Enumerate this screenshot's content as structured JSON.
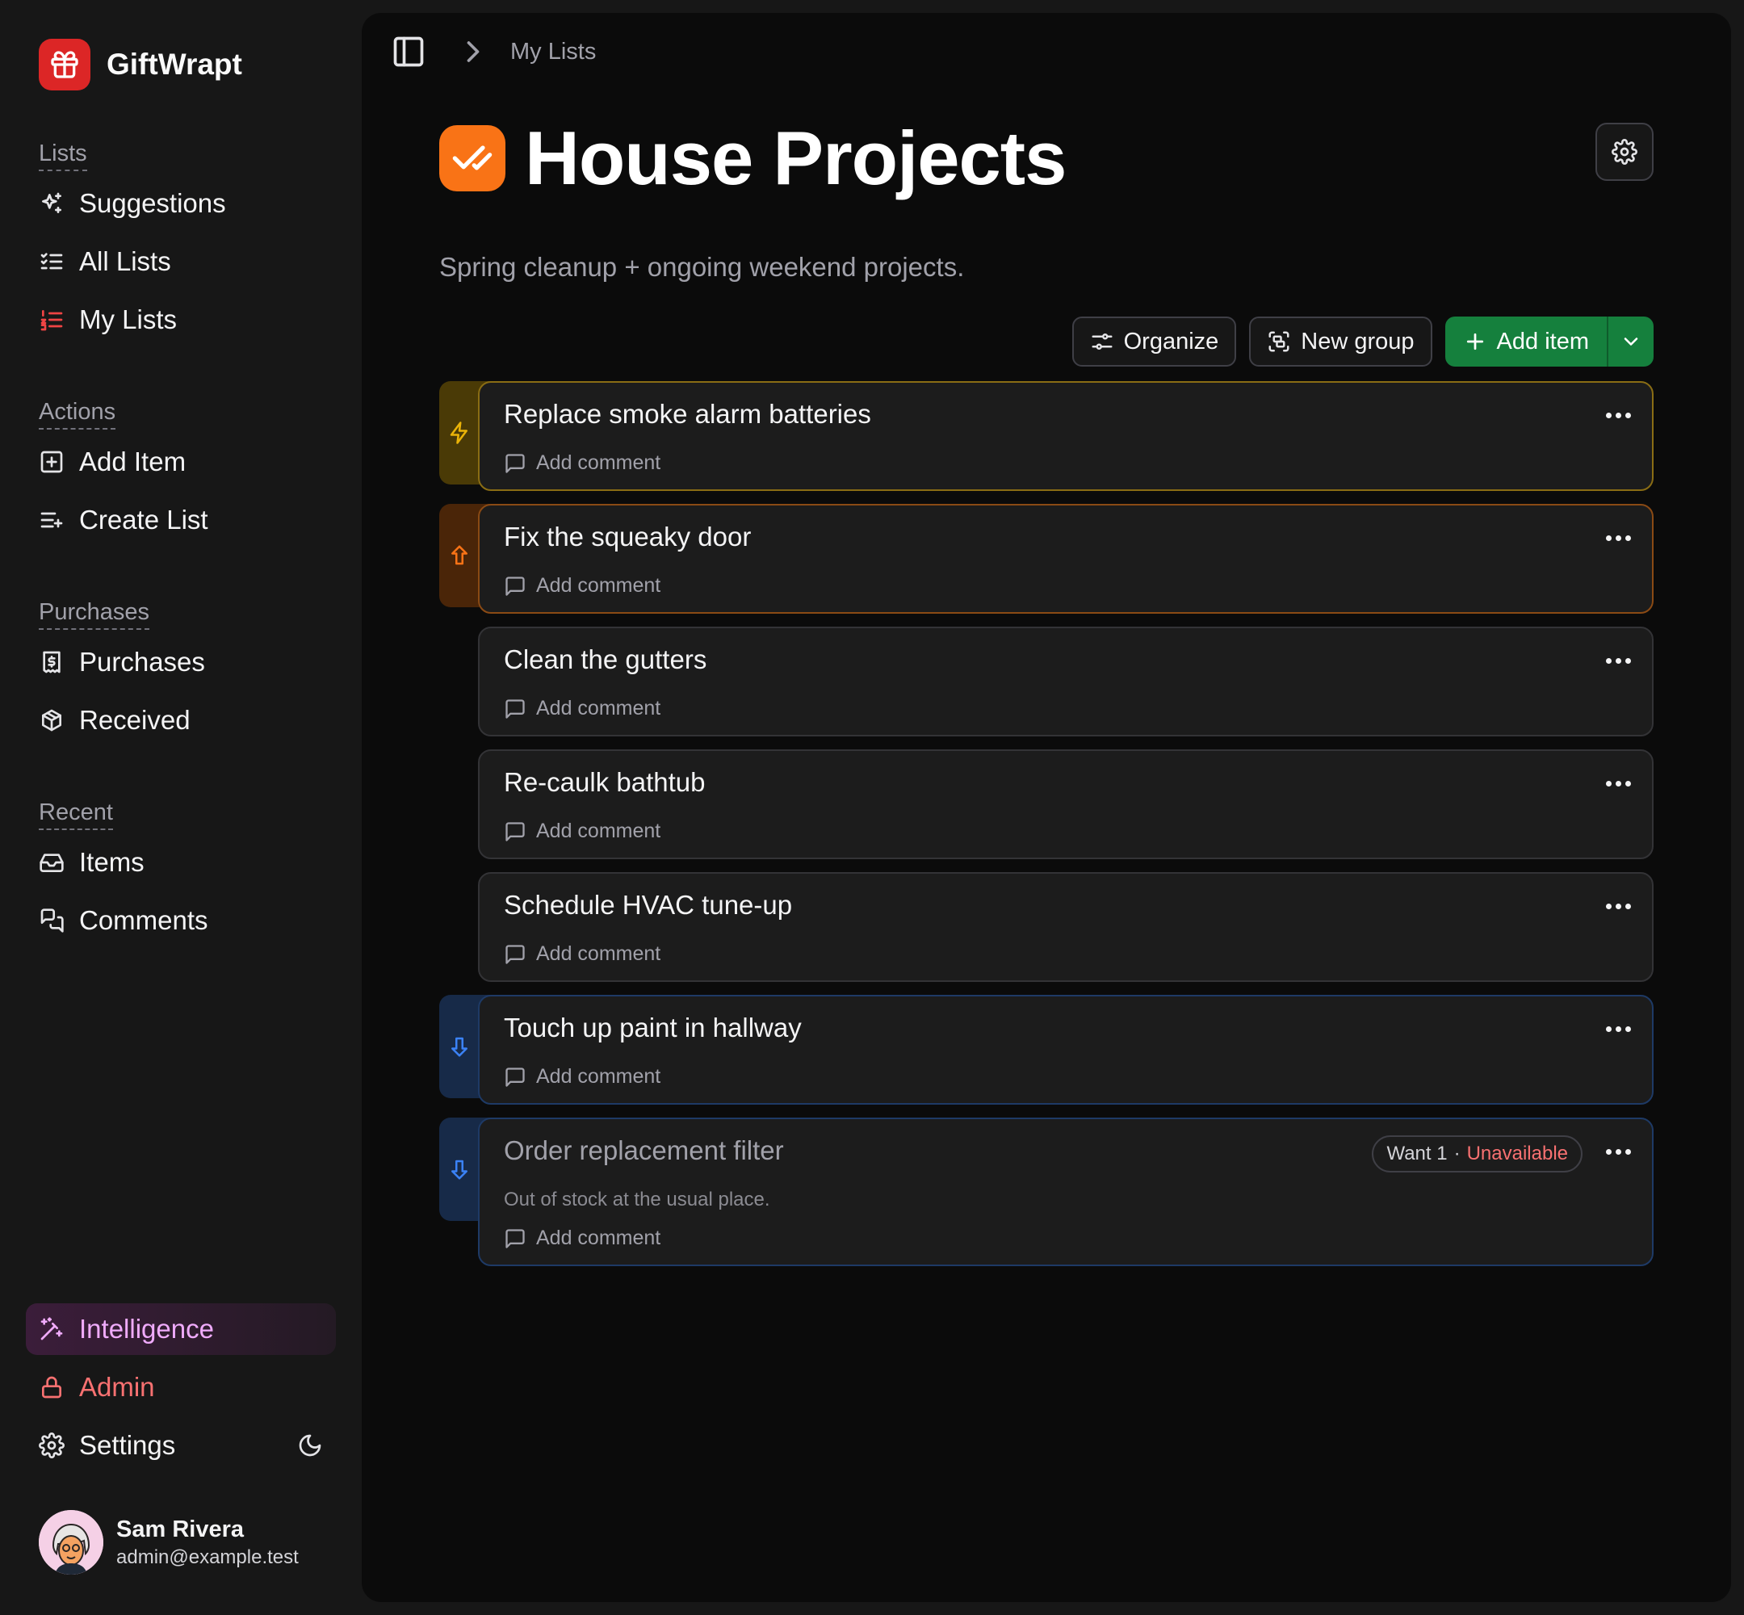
{
  "app": {
    "name": "GiftWrapt"
  },
  "sidebar": {
    "sections": [
      {
        "label": "Lists",
        "items": [
          {
            "label": "Suggestions",
            "icon": "sparkles-icon"
          },
          {
            "label": "All Lists",
            "icon": "list-checks-icon"
          },
          {
            "label": "My Lists",
            "icon": "list-ordered-icon"
          }
        ]
      },
      {
        "label": "Actions",
        "items": [
          {
            "label": "Add Item",
            "icon": "square-plus-icon"
          },
          {
            "label": "Create List",
            "icon": "list-plus-icon"
          }
        ]
      },
      {
        "label": "Purchases",
        "items": [
          {
            "label": "Purchases",
            "icon": "receipt-icon"
          },
          {
            "label": "Received",
            "icon": "package-icon"
          }
        ]
      },
      {
        "label": "Recent",
        "items": [
          {
            "label": "Items",
            "icon": "inbox-icon"
          },
          {
            "label": "Comments",
            "icon": "messages-icon"
          }
        ]
      }
    ],
    "bottom": {
      "intelligence": "Intelligence",
      "admin": "Admin",
      "settings": "Settings"
    },
    "user": {
      "name": "Sam Rivera",
      "email": "admin@example.test"
    }
  },
  "breadcrumb": {
    "current": "My Lists"
  },
  "list": {
    "title": "House Projects",
    "description": "Spring cleanup + ongoing weekend projects."
  },
  "toolbar": {
    "organize": "Organize",
    "new_group": "New group",
    "add_item": "Add item"
  },
  "items": [
    {
      "title": "Replace smoke alarm batteries",
      "priority": "high",
      "comment_label": "Add comment"
    },
    {
      "title": "Fix the squeaky door",
      "priority": "medium",
      "comment_label": "Add comment"
    },
    {
      "title": "Clean the gutters",
      "priority": "normal",
      "comment_label": "Add comment"
    },
    {
      "title": "Re-caulk bathtub",
      "priority": "normal",
      "comment_label": "Add comment"
    },
    {
      "title": "Schedule HVAC tune-up",
      "priority": "normal",
      "comment_label": "Add comment"
    },
    {
      "title": "Touch up paint in hallway",
      "priority": "low",
      "comment_label": "Add comment"
    },
    {
      "title": "Order replacement filter",
      "priority": "low",
      "note": "Out of stock at the usual place.",
      "badge_want": "Want 1",
      "badge_sep": "·",
      "badge_status": "Unavailable",
      "comment_label": "Add comment"
    }
  ],
  "colors": {
    "brand": "#dc2626",
    "title_icon": "#f97316",
    "add_item": "#15803d",
    "priority_high": "#eab308",
    "priority_medium": "#f97316",
    "priority_low": "#3b82f6",
    "unavailable": "#f87171",
    "intelligence": "#f0abfc"
  }
}
